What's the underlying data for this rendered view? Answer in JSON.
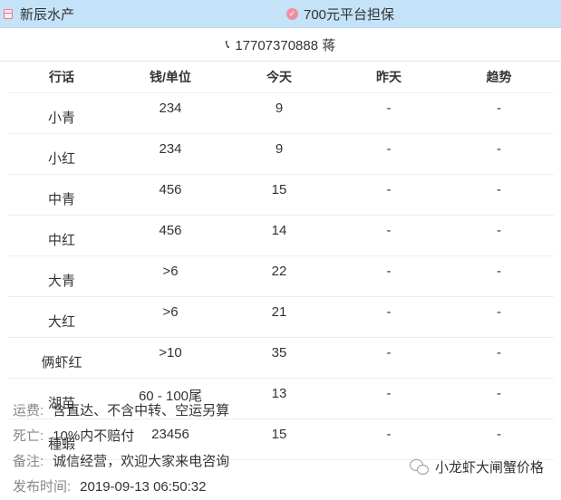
{
  "topbar": {
    "shop_name": "新辰水产",
    "guarantee": "700元平台担保"
  },
  "contact": {
    "phone_line": "17707370888 蒋"
  },
  "table": {
    "headers": [
      "行话",
      "钱/单位",
      "今天",
      "昨天",
      "趋势"
    ],
    "rows": [
      {
        "name": "小青",
        "price": "234",
        "today": "9",
        "yesterday": "-",
        "trend": "-"
      },
      {
        "name": "小红",
        "price": "234",
        "today": "9",
        "yesterday": "-",
        "trend": "-"
      },
      {
        "name": "中青",
        "price": "456",
        "today": "15",
        "yesterday": "-",
        "trend": "-"
      },
      {
        "name": "中红",
        "price": "456",
        "today": "14",
        "yesterday": "-",
        "trend": "-"
      },
      {
        "name": "大青",
        "price": ">6",
        "today": "22",
        "yesterday": "-",
        "trend": "-"
      },
      {
        "name": "大红",
        "price": ">6",
        "today": "21",
        "yesterday": "-",
        "trend": "-"
      },
      {
        "name": "俩虾红",
        "price": ">10",
        "today": "35",
        "yesterday": "-",
        "trend": "-"
      },
      {
        "name": "湖苗",
        "price": "60 - 100尾",
        "today": "13",
        "yesterday": "-",
        "trend": "-"
      },
      {
        "name": "種蝦",
        "price": "23456",
        "today": "15",
        "yesterday": "-",
        "trend": "-"
      }
    ]
  },
  "notes": {
    "shipping_label": "运费:",
    "shipping_value": "含直达、不含中转、空运另算",
    "death_label": "死亡:",
    "death_value": "10%内不赔付",
    "remark_label": "备注:",
    "remark_value": "诚信经营，欢迎大家来电咨询",
    "publish_label": "发布时间:",
    "publish_value": "2019-09-13 06:50:32"
  },
  "watermark": {
    "text": "小龙虾大闸蟹价格"
  },
  "colors": {
    "topbar_bg": "#c5e3f8",
    "accent_pink": "#ef8fa2"
  }
}
